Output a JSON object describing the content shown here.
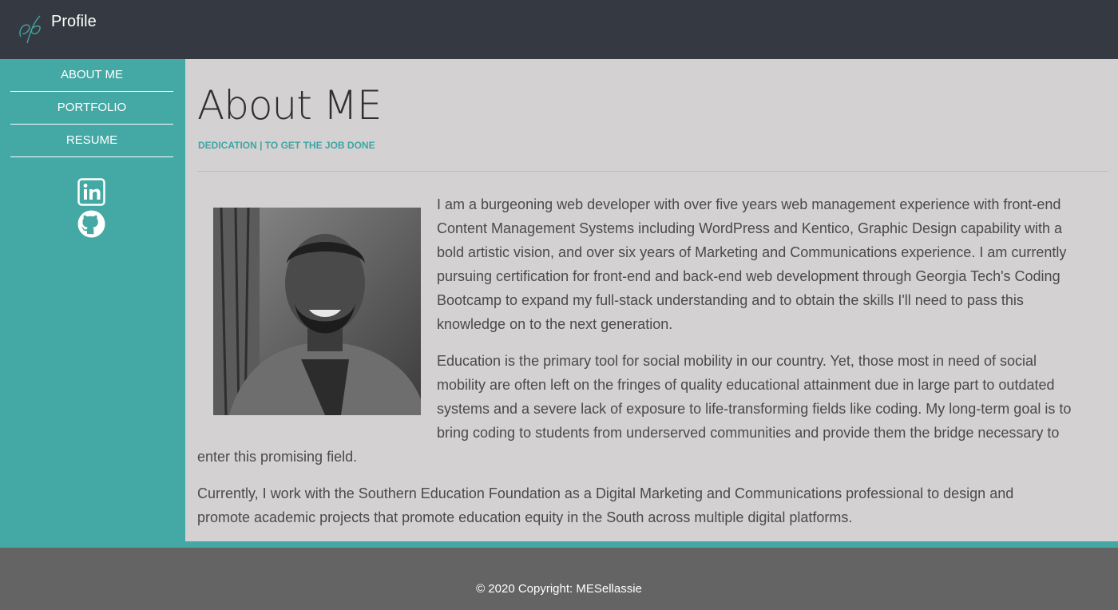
{
  "header": {
    "brand": "Profile",
    "logo_icon": "signature-logo-icon"
  },
  "sidebar": {
    "items": [
      {
        "label": "ABOUT ME"
      },
      {
        "label": "PORTFOLIO"
      },
      {
        "label": "RESUME"
      }
    ],
    "social": [
      {
        "icon": "linkedin-icon"
      },
      {
        "icon": "github-icon"
      }
    ]
  },
  "main": {
    "title": "About ME",
    "tagline": "DEDICATION | TO GET THE JOB DONE",
    "paragraph1_lines": [
      "I am a burgeoning web developer with over five years web management experience with front-end",
      "Content Management Systems including WordPress and Kentico, Graphic Design capability with a",
      "bold artistic vision, and over six years of Marketing and Communications experience. I am currently",
      "pursuing certification for front-end and back-end web development through Georgia Tech's Coding",
      "Bootcamp to expand my full-stack understanding and to obtain the skills I'll need to pass this",
      "knowledge on to the next generation."
    ],
    "paragraph2_lines": [
      "Education is the primary tool for social mobility in our country. Yet, those most in need of social",
      "mobility are often left on the fringes of quality educational attainment due in large part to outdated",
      "systems and a severe lack of exposure to life-transforming fields like coding. My long-term goal is to",
      "bring coding to students from underserved communities and provide them the bridge necessary to",
      "enter this promising field."
    ],
    "paragraph3_lines": [
      "Currently, I work with the Southern Education Foundation as a Digital Marketing and Communications professional to design and",
      "promote academic projects that promote education equity in the South across multiple digital platforms."
    ]
  },
  "footer": {
    "copyright": "© 2020 Copyright: MESellassie"
  },
  "colors": {
    "header_bg": "#353941",
    "sidebar_bg": "#44a8a4",
    "content_bg": "#d3d1d2",
    "accent": "#3ea6a3",
    "footer_bg": "#646464"
  }
}
